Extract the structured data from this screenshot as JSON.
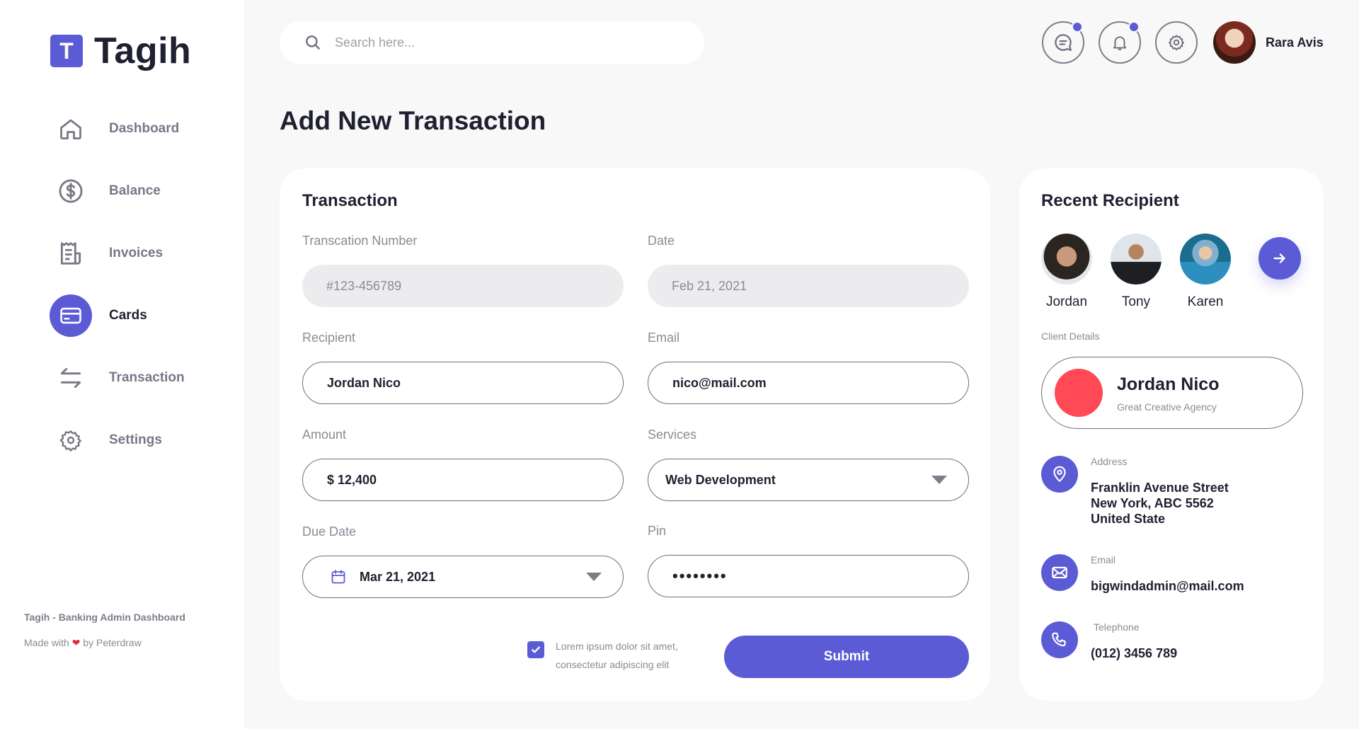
{
  "app": {
    "logo_letter": "T",
    "name": "Tagih"
  },
  "sidebar": {
    "items": [
      {
        "label": "Dashboard",
        "icon": "home-icon",
        "active": false
      },
      {
        "label": "Balance",
        "icon": "dollar-icon",
        "active": false
      },
      {
        "label": "Invoices",
        "icon": "invoice-icon",
        "active": false
      },
      {
        "label": "Cards",
        "icon": "card-icon",
        "active": true
      },
      {
        "label": "Transaction",
        "icon": "transfer-icon",
        "active": false
      },
      {
        "label": "Settings",
        "icon": "gear-icon",
        "active": false
      }
    ],
    "footer_title": "Tagih - Banking Admin Dashboard",
    "footer_made_prefix": "Made with",
    "footer_made_suffix": "by Peterdraw"
  },
  "header": {
    "search_placeholder": "Search here...",
    "user_name": "Rara Avis"
  },
  "page": {
    "title": "Add New Transaction"
  },
  "transaction": {
    "title": "Transaction",
    "number_label": "Transcation Number",
    "number_value": "#123-456789",
    "date_label": "Date",
    "date_value": "Feb 21, 2021",
    "recipient_label": "Recipient",
    "recipient_value": "Jordan Nico",
    "email_label": "Email",
    "email_value": "nico@mail.com",
    "amount_label": "Amount",
    "amount_value": "$ 12,400",
    "services_label": "Services",
    "services_value": "Web Development",
    "due_label": "Due Date",
    "due_value": "Mar 21, 2021",
    "pin_label": "Pin",
    "pin_value": "••••••••",
    "checkbox_text": "Lorem ipsum dolor sit amet, consectetur adipiscing elit",
    "submit_label": "Submit"
  },
  "recipient": {
    "title": "Recent Recipient",
    "people": [
      {
        "name": "Jordan"
      },
      {
        "name": "Tony"
      },
      {
        "name": "Karen"
      }
    ],
    "client_details_label": "Client Details",
    "client_name": "Jordan Nico",
    "client_sub": "Great Creative Agency",
    "address_label": "Address",
    "address_line1": "Franklin Avenue Street",
    "address_line2": "New York, ABC 5562",
    "address_line3": "United State",
    "email_label": "Email",
    "email_value": "bigwindadmin@mail.com",
    "phone_label": "Telephone",
    "phone_value": "(012) 3456 789"
  },
  "colors": {
    "accent": "#5b5bd6",
    "client_dot": "#ff4a55",
    "background": "#f8f8f8"
  }
}
